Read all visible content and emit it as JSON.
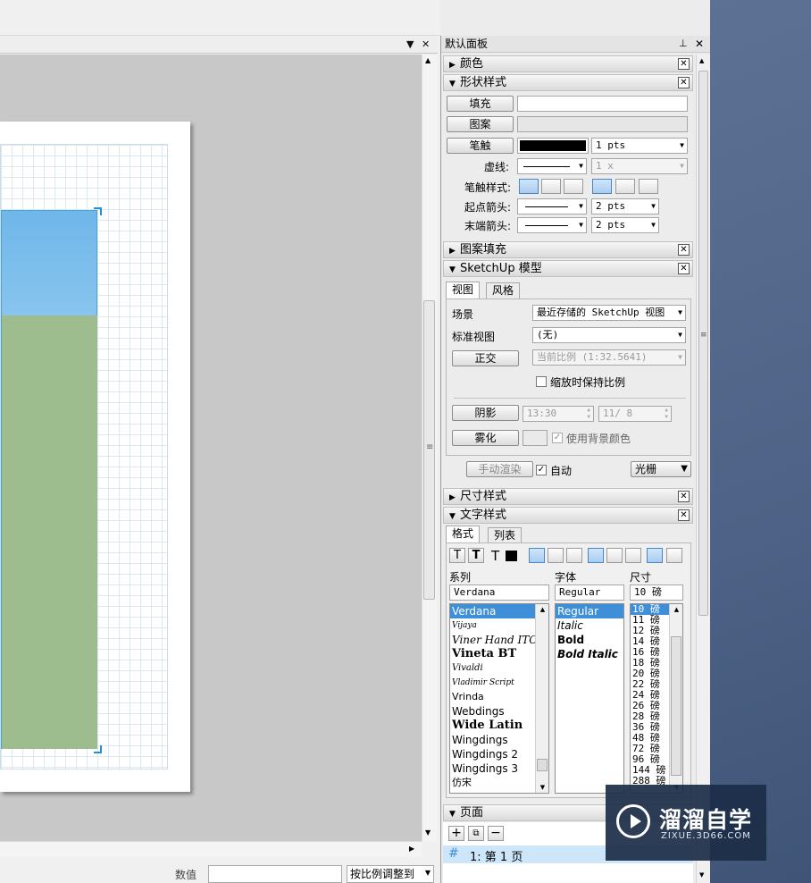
{
  "panel": {
    "title": "默认面板",
    "pin_glyph": "⊥",
    "close_glyph": "✕"
  },
  "sections": {
    "color": {
      "title": "颜色",
      "collapsed": true
    },
    "shape_style": {
      "title": "形状样式",
      "fill_button": "填充",
      "pattern_button": "图案",
      "stroke_button": "笔触",
      "stroke_width": "1 pts",
      "dash_label": "虚线:",
      "dash_scale": "1 x",
      "stroke_style_label": "笔触样式:",
      "start_arrow_label": "起点箭头:",
      "start_arrow_size": "2 pts",
      "end_arrow_label": "末端箭头:",
      "end_arrow_size": "2 pts"
    },
    "pattern_fill": {
      "title": "图案填充",
      "collapsed": true
    },
    "sketchup_model": {
      "title": "SketchUp 模型",
      "tabs": [
        "视图",
        "风格"
      ],
      "scene_label": "场景",
      "scene_value": "最近存储的 SketchUp 视图",
      "standard_view_label": "标准视图",
      "standard_view_value": "(无)",
      "ortho_button": "正交",
      "scale_value": "当前比例 (1:32.5641)",
      "keep_scale_label": "缩放时保持比例",
      "shadow_button": "阴影",
      "shadow_time": "13:30",
      "shadow_date": "11/ 8",
      "fog_button": "雾化",
      "use_bg_color_label": "使用背景颜色",
      "render_button": "手动渲染",
      "auto_label": "自动",
      "render_mode": "光栅"
    },
    "dimension_style": {
      "title": "尺寸样式",
      "collapsed": true
    },
    "text_style": {
      "title": "文字样式",
      "tabs": [
        "格式",
        "列表"
      ],
      "family_label": "系列",
      "font_label": "字体",
      "size_label": "尺寸",
      "family_value": "Verdana",
      "font_value": "Regular",
      "size_value": "10 磅",
      "families": [
        "Verdana",
        "Vijaya",
        "Viner Hand ITC",
        "Vineta BT",
        "Vivaldi",
        "Vladimir Script",
        "Vrinda",
        "Webdings",
        "Wide Latin",
        "Wingdings",
        "Wingdings 2",
        "Wingdings 3",
        "仿宋"
      ],
      "styles": [
        "Regular",
        "Italic",
        "Bold",
        "Bold Italic"
      ],
      "sizes": [
        "10 磅",
        "11 磅",
        "12 磅",
        "14 磅",
        "16 磅",
        "18 磅",
        "20 磅",
        "22 磅",
        "24 磅",
        "26 磅",
        "28 磅",
        "36 磅",
        "48 磅",
        "72 磅",
        "96 磅",
        "144 磅",
        "288 磅"
      ]
    },
    "pages": {
      "title": "页面",
      "page_marker": "#",
      "page_item": "1: 第 1 页"
    }
  },
  "status": {
    "value_label": "数值",
    "scale_select": "按比例调整到"
  },
  "watermark": {
    "name": "溜溜自学",
    "url": "ZIXUE.3D66.COM"
  },
  "colors": {
    "selection": "#3f8fd8",
    "viewport_border": "#4aa3d8",
    "ground": "#9dbd8e",
    "sky_top": "#6fb7ea"
  }
}
